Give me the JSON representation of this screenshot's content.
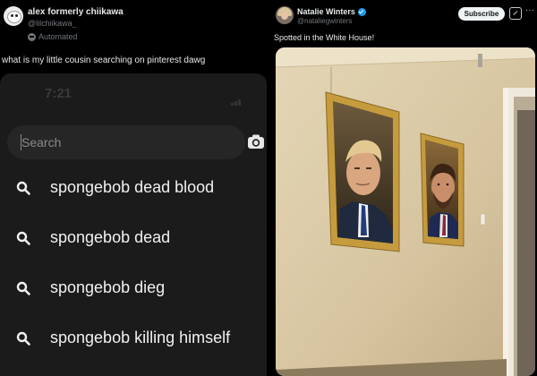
{
  "left_post": {
    "author_name": "alex formerly chiikawa",
    "handle": "@lilchiikawa_",
    "badge": "Automated",
    "text": "what is my little cousin searching on pinterest dawg",
    "screenshot": {
      "time": "7:21",
      "search_placeholder": "Search",
      "suggestions": [
        "spongebob dead blood",
        "spongebob dead",
        "spongebob dieg",
        "spongebob killing himself"
      ]
    }
  },
  "right_post": {
    "author_name": "Natalie Winters",
    "handle": "@nataliegwinters",
    "subscribe_label": "Subscribe",
    "more_label": "···",
    "text": "Spotted in the White House!"
  },
  "colors": {
    "background": "#000000",
    "text_primary": "#e7e9ea",
    "text_secondary": "#71767b",
    "verified_blue": "#1d9bf0",
    "wall": "#d9c8a6",
    "frame_gold": "#c9a14a"
  },
  "icons": {
    "search": "search-icon",
    "camera": "camera-icon",
    "verified": "verified-badge-icon",
    "automated": "bot-icon",
    "more": "more-icon",
    "grok": "grok-icon"
  }
}
